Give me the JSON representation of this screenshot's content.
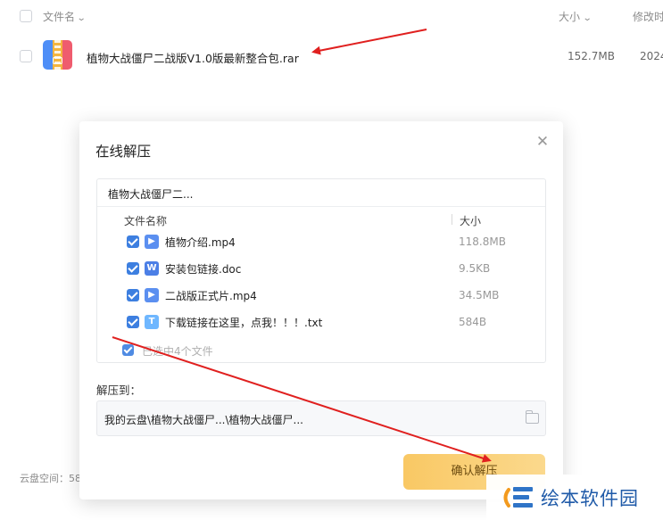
{
  "file_list": {
    "columns": {
      "name": "文件名",
      "size": "大小",
      "modified": "修改时"
    },
    "file": {
      "name": "植物大战僵尸二战版V1.0版最新整合包.rar",
      "size": "152.7MB",
      "modified": "2024"
    }
  },
  "footer": {
    "storage_label": "云盘空间：58"
  },
  "dialog": {
    "title": "在线解压",
    "close_glyph": "✕",
    "tree": {
      "root": "植物大战僵尸二...",
      "col_name": "文件名称",
      "col_size": "大小",
      "entries": [
        {
          "name": "植物介绍.mp4",
          "size": "118.8MB",
          "icon": "video-icon",
          "glyph": "▶"
        },
        {
          "name": "安装包链接.doc",
          "size": "9.5KB",
          "icon": "word-icon",
          "glyph": "W"
        },
        {
          "name": "二战版正式片.mp4",
          "size": "34.5MB",
          "icon": "video-icon",
          "glyph": "▶"
        },
        {
          "name": "下载链接在这里，点我！！！.txt",
          "size": "584B",
          "icon": "txt-icon",
          "glyph": "T"
        }
      ],
      "selected_text": "已选中4个文件"
    },
    "extract_label": "解压到：",
    "path": "我的云盘\\植物大战僵尸...\\植物大战僵尸...",
    "confirm_label": "确认解压"
  },
  "watermark": {
    "text": "绘本软件园"
  },
  "colors": {
    "accent_blue": "#3d7fe0",
    "confirm_yellow": "#f9c864",
    "arrow_red": "#e0201f"
  }
}
